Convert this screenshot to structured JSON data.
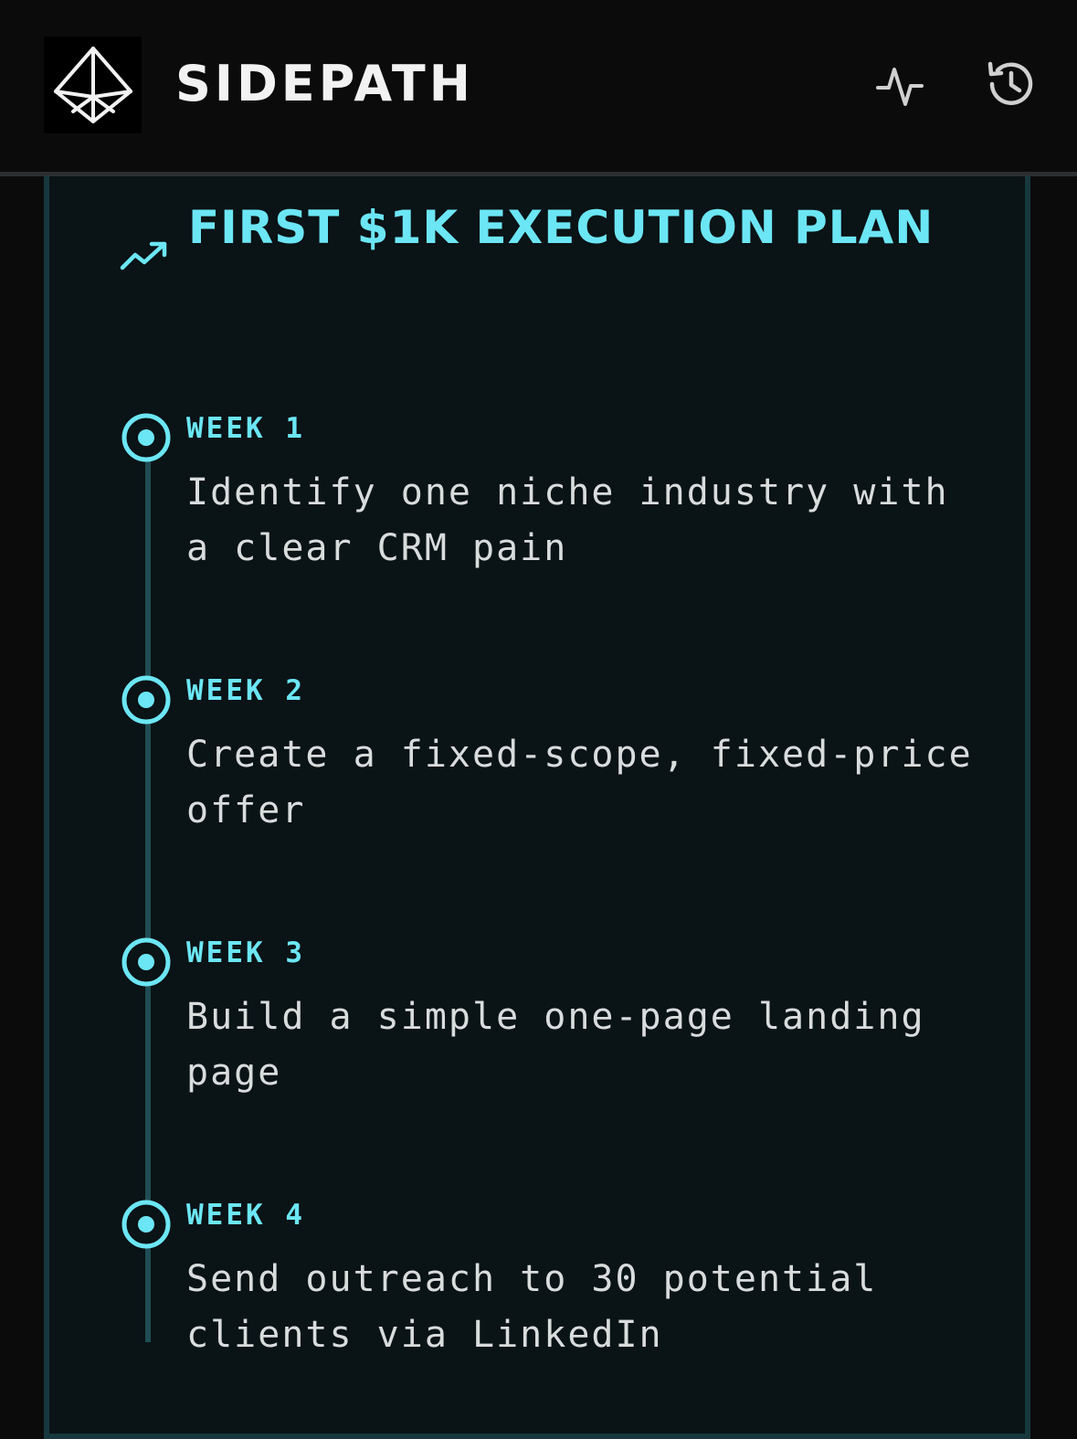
{
  "header": {
    "brand": "SIDEPATH",
    "logo_icon": "geometric-diamond-logo",
    "actions": [
      {
        "name": "activity",
        "icon": "activity-pulse-icon"
      },
      {
        "name": "history",
        "icon": "history-clock-icon"
      }
    ]
  },
  "plan": {
    "title": "FIRST $1K EXECUTION PLAN",
    "title_icon": "trending-up-icon",
    "steps": [
      {
        "week": "WEEK 1",
        "text": "Identify one niche industry with a clear CRM pain"
      },
      {
        "week": "WEEK 2",
        "text": "Create a fixed-scope, fixed-price offer"
      },
      {
        "week": "WEEK 3",
        "text": "Build a simple one-page landing page"
      },
      {
        "week": "WEEK 4",
        "text": "Send outreach to 30 potential clients via LinkedIn"
      }
    ]
  },
  "colors": {
    "accent": "#6ce6f4",
    "background": "#0b0b0b",
    "card": "#0a1316",
    "card_border": "#17383d",
    "timeline": "#1f4d55",
    "body_text": "#d9dcdd"
  }
}
